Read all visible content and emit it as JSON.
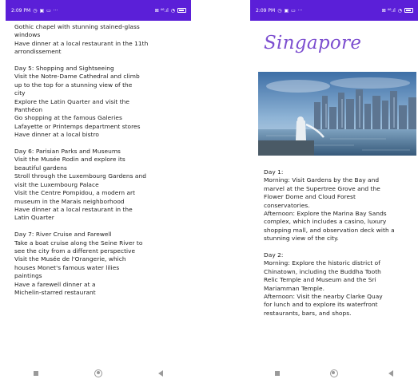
{
  "status_bar": {
    "time": "2:09 PM",
    "right_icons": "⊠ ⁴⁶.ıl",
    "left_icons": [
      "sync-icon",
      "notification-icon",
      "cast-icon",
      "more-icon"
    ]
  },
  "left_screen": {
    "lines": [
      "Gothic chapel with stunning stained-glass",
      "windows",
      "Have dinner at a local restaurant in the 11th",
      "arrondissement",
      "",
      "Day 5: Shopping and Sightseeing",
      "Visit the Notre-Dame Cathedral and climb",
      "up to the top for a stunning view of the",
      "city",
      "Explore the Latin Quarter and visit the",
      "Panthéon",
      "Go shopping at the famous Galeries",
      "Lafayette or Printemps department stores",
      "Have dinner at a local bistro",
      "",
      "Day 6: Parisian Parks and Museums",
      "Visit the Musée Rodin and explore its",
      "beautiful gardens",
      "Stroll through the Luxembourg Gardens and",
      "visit the Luxembourg Palace",
      "Visit the Centre Pompidou, a modern art",
      "museum in the Marais neighborhood",
      "Have dinner at a local restaurant in the",
      "Latin Quarter",
      "",
      "Day 7: River Cruise and Farewell",
      "Take a boat cruise along the Seine River to",
      "see the city from a different perspective",
      "Visit the Musée de l'Orangerie, which",
      "houses Monet's famous water lilies",
      "paintings",
      "Have a farewell dinner at a",
      "Michelin-starred restaurant"
    ]
  },
  "right_screen": {
    "title": "Singapore",
    "image_icon": "singapore-skyline-image",
    "lines": [
      "Day 1:",
      "Morning: Visit Gardens by the Bay and",
      "marvel at the Supertree Grove and the",
      "Flower Dome and Cloud Forest",
      "conservatories.",
      "Afternoon: Explore the Marina Bay Sands",
      "complex, which includes a casino, luxury",
      "shopping mall, and observation deck with a",
      "stunning view of the city.",
      "",
      "Day 2:",
      "Morning: Explore the historic district of",
      "Chinatown, including the Buddha Tooth",
      "Relic Temple and Museum and the Sri",
      "Mariamman Temple.",
      "Afternoon: Visit the nearby Clarke Quay",
      "for lunch and to explore its waterfront",
      "restaurants, bars, and shops."
    ]
  },
  "nav_bar": {
    "icons": [
      "recents-square-icon",
      "home-circle-icon",
      "back-triangle-icon"
    ]
  },
  "colors": {
    "status_bar": "#5b1fd8",
    "title": "#7d4fd0",
    "text": "#1c1c1c"
  }
}
